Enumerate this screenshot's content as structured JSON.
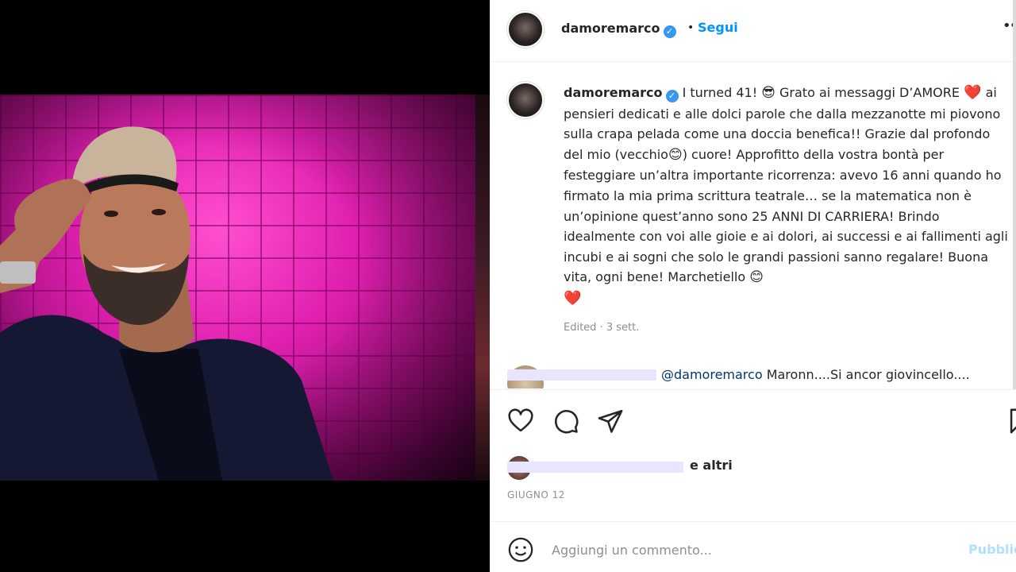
{
  "post": {
    "username": "damoremarco",
    "verified_icon": "verified-badge-icon",
    "follow_separator": "•",
    "follow_label": "Segui",
    "more_icon": "more-options-icon"
  },
  "caption": {
    "username": "damoremarco",
    "part1": " I turned 41! ",
    "emoji1": "😎",
    "part2": " Grato ai messaggi D’AMORE ",
    "heart1": "❤️",
    "part3": " ai pensieri dedicati e alle dolci parole che dalla mezzanotte mi piovono sulla crapa pelada come una doccia benefica!! Grazie dal profondo del mio (vecchio",
    "emoji2": "😊",
    "part4": ") cuore! Approfitto della vostra bontà per festeggiare un’altra importante ricorrenza: avevo 16 anni quando ho firmato la mia prima scrittura teatrale… se la matematica non è un’opinione quest’anno sono 25 ANNI DI CARRIERA! Brindo idealmente con voi alle gioie e ai dolori, ai successi e ai fallimenti agli incubi e ai sogni che solo le grandi passioni sanno regalare! Buona vita, ogni bene! Marchetiello ",
    "emoji3": "😊",
    "heart2": "❤️",
    "meta": "Edited · 3 sett."
  },
  "reply": {
    "mention": "@damoremarco",
    "text": " Maronn....Si ancor giovincello...."
  },
  "actions": {
    "like_icon": "heart-icon",
    "comment_icon": "comment-icon",
    "share_icon": "share-icon",
    "save_icon": "bookmark-icon"
  },
  "likes": {
    "text": "e altri"
  },
  "date": "GIUGNO 12",
  "add_comment": {
    "emoji_icon": "emoji-icon",
    "placeholder": "Aggiungi un commento...",
    "post_label": "Pubblica"
  },
  "colors": {
    "link": "#0095f6",
    "verified": "#3897f0",
    "heart": "#e0245e",
    "muted": "#8e8e8e"
  }
}
